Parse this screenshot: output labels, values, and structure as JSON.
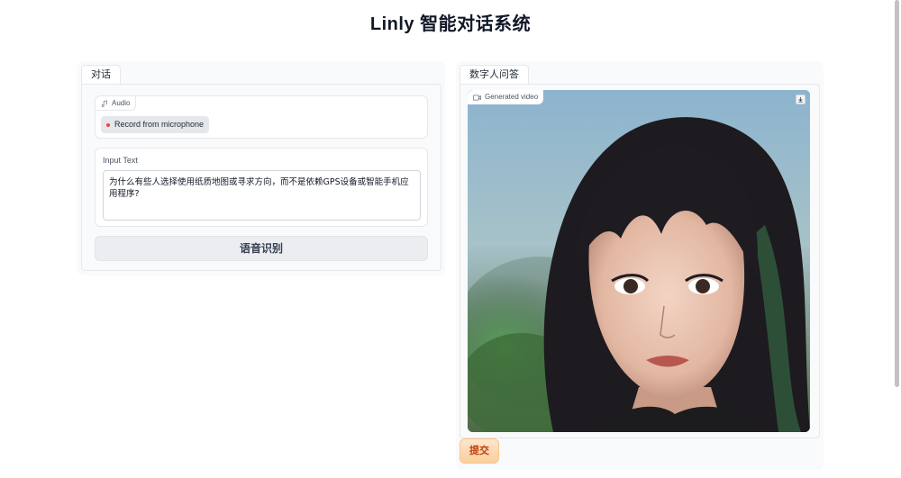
{
  "page": {
    "title": "Linly 智能对话系统"
  },
  "left_panel": {
    "tab_label": "对话",
    "audio": {
      "label": "Audio",
      "record_button": "Record from microphone",
      "icon": "music-note-icon"
    },
    "input_text": {
      "label": "Input Text",
      "value": "为什么有些人选择使用纸质地图或寻求方向，而不是依赖GPS设备或智能手机应用程序?"
    },
    "action_button": "语音识别"
  },
  "right_panel": {
    "tab_label": "数字人问答",
    "video": {
      "label": "Generated video",
      "icon": "video-camera-icon",
      "download_icon": "download-icon"
    },
    "submit_button": "提交"
  },
  "colors": {
    "accent": "#f97316",
    "submit_bg": "#fbcf9d",
    "record_dot": "#ef4444"
  }
}
